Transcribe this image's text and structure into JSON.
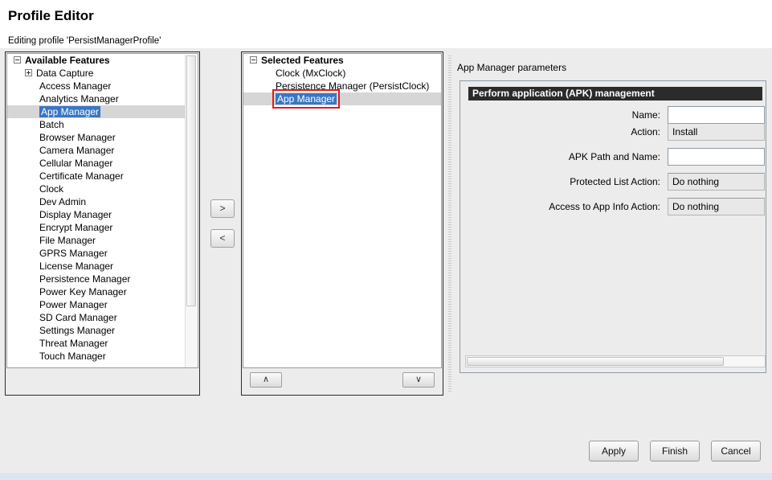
{
  "header": {
    "title": "Profile Editor",
    "subtitle": "Editing profile 'PersistManagerProfile'"
  },
  "available_panel": {
    "root_label": "Available Features",
    "root_icon": "minus-box-icon",
    "items": [
      {
        "label": "Data Capture",
        "icon": "plus-box-icon",
        "expandable": true,
        "selected": false
      },
      {
        "label": "Access Manager",
        "selected": false
      },
      {
        "label": "Analytics Manager",
        "selected": false
      },
      {
        "label": "App Manager",
        "selected": true
      },
      {
        "label": "Batch",
        "selected": false
      },
      {
        "label": "Browser Manager",
        "selected": false
      },
      {
        "label": "Camera Manager",
        "selected": false
      },
      {
        "label": "Cellular Manager",
        "selected": false
      },
      {
        "label": "Certificate Manager",
        "selected": false
      },
      {
        "label": "Clock",
        "selected": false
      },
      {
        "label": "Dev Admin",
        "selected": false
      },
      {
        "label": "Display Manager",
        "selected": false
      },
      {
        "label": "Encrypt Manager",
        "selected": false
      },
      {
        "label": "File Manager",
        "selected": false
      },
      {
        "label": "GPRS Manager",
        "selected": false
      },
      {
        "label": "License Manager",
        "selected": false
      },
      {
        "label": "Persistence Manager",
        "selected": false
      },
      {
        "label": "Power Key Manager",
        "selected": false
      },
      {
        "label": "Power Manager",
        "selected": false
      },
      {
        "label": "SD Card Manager",
        "selected": false
      },
      {
        "label": "Settings Manager",
        "selected": false
      },
      {
        "label": "Threat Manager",
        "selected": false
      },
      {
        "label": "Touch Manager",
        "selected": false
      }
    ]
  },
  "transfer": {
    "add_label": ">",
    "remove_label": "<"
  },
  "selected_panel": {
    "root_label": "Selected Features",
    "root_icon": "minus-box-icon",
    "items": [
      {
        "label": "Clock (MxClock)",
        "selected": false,
        "highlighted": false
      },
      {
        "label": "Persistence Manager (PersistClock)",
        "selected": false,
        "highlighted": false
      },
      {
        "label": "App Manager",
        "selected": true,
        "highlighted": true
      }
    ],
    "move_up_label": "∧",
    "move_down_label": "∨"
  },
  "parameters_panel": {
    "title": "App Manager parameters",
    "group_header": "Perform application (APK) management",
    "fields": [
      {
        "label": "Name:",
        "type": "text",
        "value": ""
      },
      {
        "label": "Action:",
        "type": "combo",
        "value": "Install"
      },
      {
        "label": "APK Path and Name:",
        "type": "text",
        "value": ""
      },
      {
        "label": "Protected List Action:",
        "type": "combo",
        "value": "Do nothing"
      },
      {
        "label": "Access to App Info Action:",
        "type": "combo",
        "value": "Do nothing"
      }
    ]
  },
  "footer": {
    "buttons": [
      {
        "label": "Apply"
      },
      {
        "label": "Finish"
      },
      {
        "label": "Cancel"
      }
    ]
  },
  "colors": {
    "selection_blue": "#3a76c4",
    "selection_row_gray": "#d6d6d6",
    "annotation_red": "#e01b1b",
    "group_header_dark": "#2b2b2b",
    "window_background": "#ececec",
    "bottom_strip": "#dce6f1"
  }
}
